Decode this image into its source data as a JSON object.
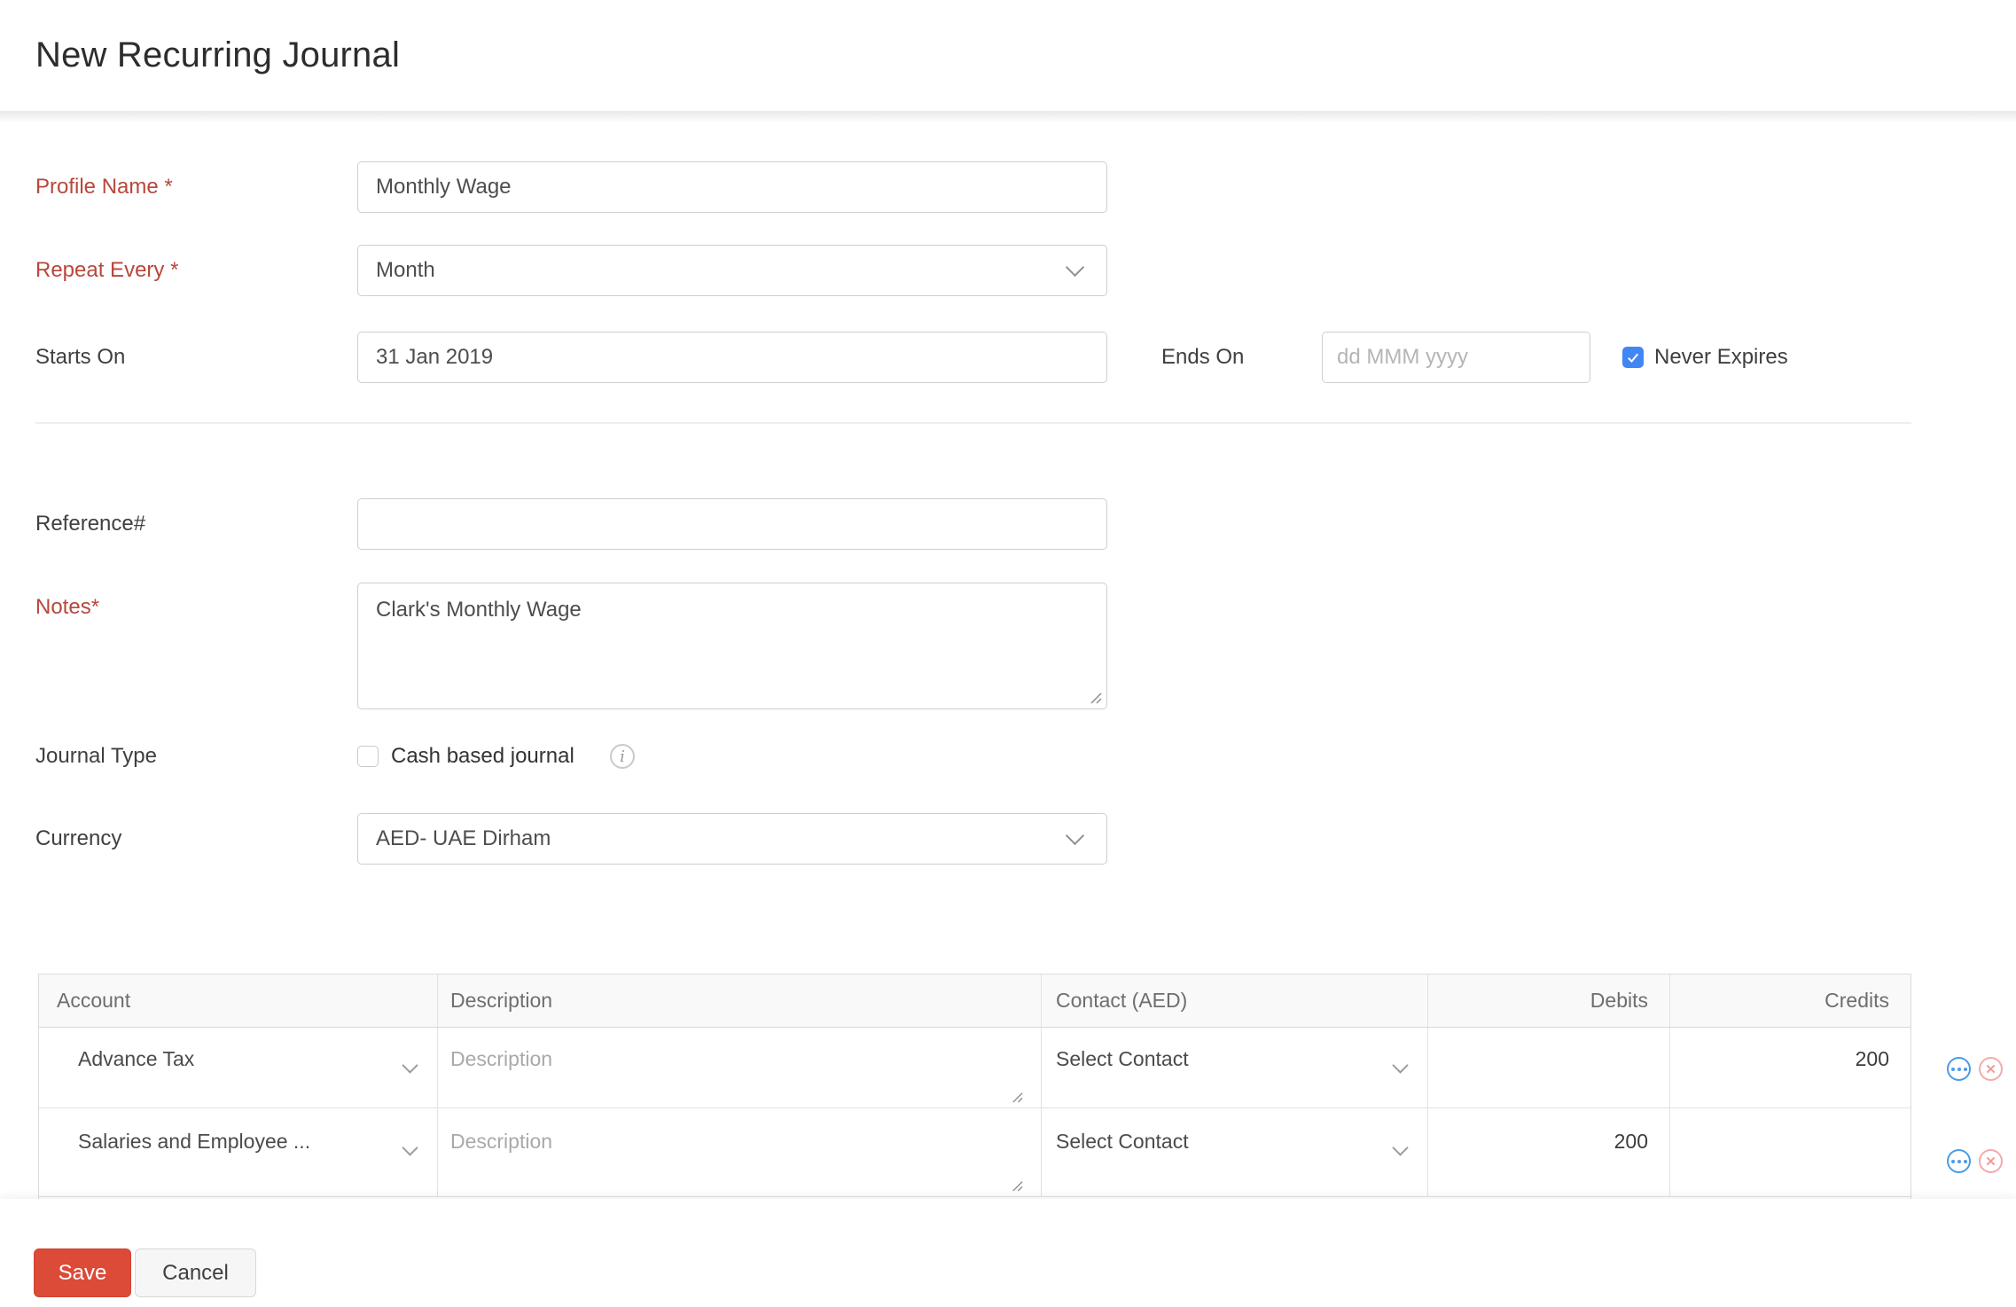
{
  "page_title": "New Recurring Journal",
  "colors": {
    "accent_red": "#dc4a38",
    "label_red": "#b8473c",
    "checkbox_blue": "#4285f4",
    "row_action_blue": "#4a9be8",
    "row_action_pink": "#f3aaaa"
  },
  "icons": {
    "select_chevron": "chevron-down",
    "info": "info-circle",
    "row_menu": "ellipsis-circle",
    "row_remove": "x-circle",
    "resize": "textarea-resize-grip"
  },
  "form": {
    "profile_name": {
      "label": "Profile Name *",
      "value": "Monthly Wage"
    },
    "repeat_every": {
      "label": "Repeat Every *",
      "value": "Month"
    },
    "starts_on": {
      "label": "Starts On",
      "value": "31 Jan 2019"
    },
    "ends_on": {
      "label": "Ends On",
      "placeholder": "dd MMM yyyy",
      "value": ""
    },
    "never_expires": {
      "label": "Never Expires",
      "checked": true
    },
    "reference": {
      "label": "Reference#",
      "value": ""
    },
    "notes": {
      "label": "Notes*",
      "value": "Clark's Monthly Wage"
    },
    "journal_type": {
      "label": "Journal Type",
      "checkbox_label": "Cash based journal",
      "checked": false
    },
    "currency": {
      "label": "Currency",
      "value": "AED- UAE Dirham"
    }
  },
  "table": {
    "headers": [
      "Account",
      "Description",
      "Contact (AED)",
      "Debits",
      "Credits"
    ],
    "rows": [
      {
        "account": "Advance Tax",
        "description_placeholder": "Description",
        "contact": "Select Contact",
        "debits": "",
        "credits": "200"
      },
      {
        "account": "Salaries and Employee ...",
        "description_placeholder": "Description",
        "contact": "Select Contact",
        "debits": "200",
        "credits": ""
      }
    ]
  },
  "footer": {
    "save_label": "Save",
    "cancel_label": "Cancel"
  }
}
